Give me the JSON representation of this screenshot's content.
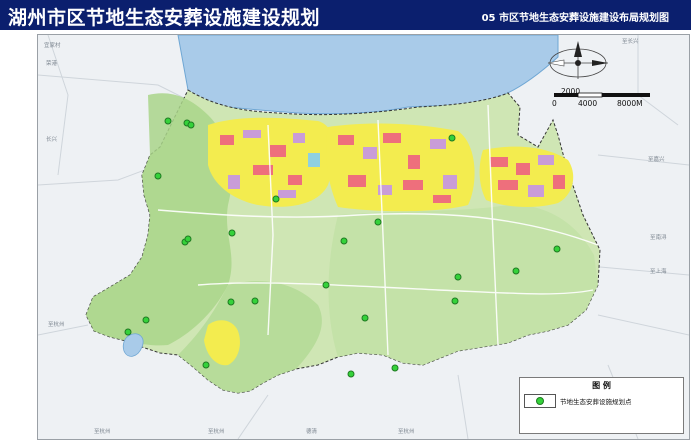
{
  "header": {
    "title": "湖州市区节地生态安葬设施建设规划",
    "subtitle": "05 市区节地生态安葬设施建设布局规划图",
    "background_color": "#0b1f6e"
  },
  "map": {
    "region": "湖州市区",
    "fill_colors": {
      "water": "#a9cbe9",
      "urban_residential": "#f3ec4f",
      "commercial": "#ee6f7c",
      "industrial": "#c99cd8",
      "green": "#a9d58a",
      "rural_area": "#cfe6b4"
    },
    "markers": {
      "legend_label": "节地生态安葬设施规划点",
      "marker_color": "#35d23a",
      "count": 24
    }
  },
  "compass": {
    "symbol": "north-arrow-icon"
  },
  "scale_bar": {
    "labels": [
      "2000",
      "0",
      "4000",
      "8000M"
    ]
  },
  "legend": {
    "title": "图 例",
    "items": [
      {
        "label": "节地生态安葬设施规划点",
        "icon": "green-dot-icon"
      }
    ]
  },
  "place_labels": [
    "宜家村",
    "荣港",
    "长兴",
    "至杭州",
    "至长兴",
    "至嘉兴",
    "至南浔",
    "至上海",
    "至杭州",
    "至杭州",
    "德清",
    "至杭州"
  ]
}
